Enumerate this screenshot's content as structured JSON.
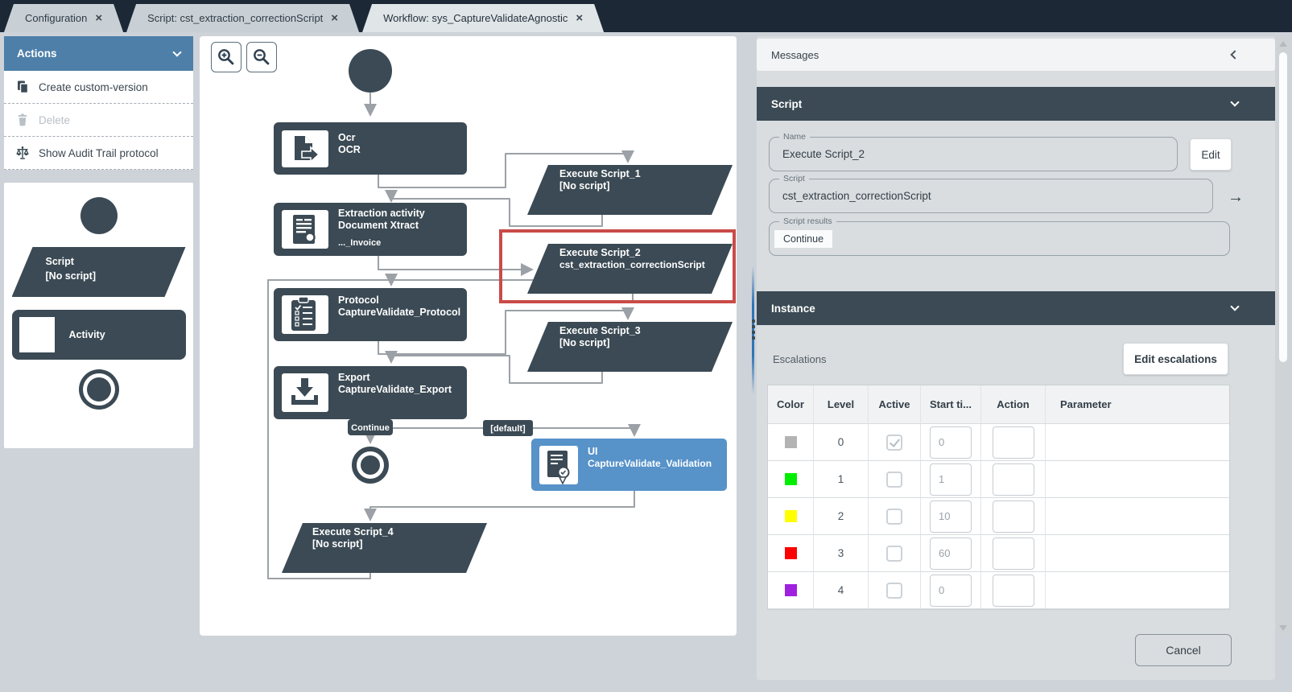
{
  "icons": {
    "close_glyph": "×",
    "arrow_right_glyph": "→"
  },
  "colors": {
    "accent_blue": "#4d7fa9",
    "node_dark": "#3b4a54",
    "ui_node_blue": "#5792c9",
    "selection_red": "#c94b48",
    "topbar": "#1c2836",
    "panel_bg": "#d9dde0"
  },
  "tabs": [
    {
      "label": "Configuration",
      "active": false
    },
    {
      "label": "Script: cst_extraction_correctionScript",
      "active": false
    },
    {
      "label": "Workflow: sys_CaptureValidateAgnostic",
      "active": true
    }
  ],
  "sidebar": {
    "actions": {
      "title": "Actions",
      "items": [
        {
          "label": "Create custom-version",
          "icon": "copy-icon",
          "disabled": false
        },
        {
          "label": "Delete",
          "icon": "trash-icon",
          "disabled": true
        },
        {
          "label": "Show Audit Trail protocol",
          "icon": "scales-icon",
          "disabled": false
        }
      ]
    },
    "palette": {
      "script": {
        "line1": "Script",
        "line2": "[No script]"
      },
      "activity_label": "Activity"
    }
  },
  "canvas": {
    "nodes": {
      "ocr": {
        "line1": "Ocr",
        "line2": "OCR"
      },
      "extraction": {
        "line1": "Extraction activity",
        "line2": "Document Xtract",
        "line3": "..._Invoice"
      },
      "script1": {
        "line1": "Execute Script_1",
        "line2": "[No script]"
      },
      "script2": {
        "line1": "Execute Script_2",
        "line2": "cst_extraction_correctionScript",
        "selected": true
      },
      "protocol": {
        "line1": "Protocol",
        "line2": "CaptureValidate_Protocol"
      },
      "script3": {
        "line1": "Execute Script_3",
        "line2": "[No script]"
      },
      "export": {
        "line1": "Export",
        "line2": "CaptureValidate_Export"
      },
      "ui": {
        "line1": "UI",
        "line2": "CaptureValidate_Validation"
      },
      "script4": {
        "line1": "Execute Script_4",
        "line2": "[No script]"
      }
    },
    "badges": {
      "continue": "Continue",
      "default_branch": "[default]"
    }
  },
  "inspector": {
    "messages_title": "Messages",
    "script": {
      "title": "Script",
      "name_label": "Name",
      "name_value": "Execute Script_2",
      "edit_label": "Edit",
      "script_label": "Script",
      "script_value": "cst_extraction_correctionScript",
      "results_label": "Script results",
      "results_chip": "Continue"
    },
    "instance": {
      "title": "Instance",
      "escalations_label": "Escalations",
      "edit_escalations_label": "Edit escalations",
      "table": {
        "headers": [
          "Color",
          "Level",
          "Active",
          "Start ti...",
          "Action",
          "Parameter"
        ],
        "rows": [
          {
            "color": "#b3b3b3",
            "level": "0",
            "active": true,
            "start_time": "0",
            "action": "",
            "parameter": ""
          },
          {
            "color": "#00ee00",
            "level": "1",
            "active": false,
            "start_time": "1",
            "action": "",
            "parameter": ""
          },
          {
            "color": "#ffff00",
            "level": "2",
            "active": false,
            "start_time": "10",
            "action": "",
            "parameter": ""
          },
          {
            "color": "#ff0000",
            "level": "3",
            "active": false,
            "start_time": "60",
            "action": "",
            "parameter": ""
          },
          {
            "color": "#a020e0",
            "level": "4",
            "active": false,
            "start_time": "0",
            "action": "",
            "parameter": ""
          }
        ]
      }
    },
    "cancel_label": "Cancel"
  }
}
